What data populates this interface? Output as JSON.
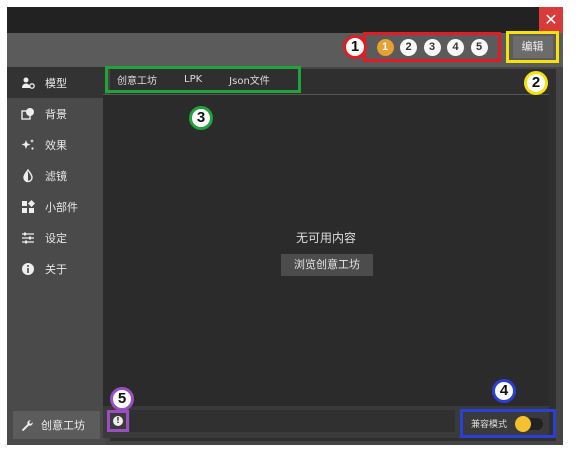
{
  "window": {
    "close_glyph": "✕"
  },
  "topbar": {
    "slots": [
      {
        "label": "1",
        "active": true
      },
      {
        "label": "2",
        "active": false
      },
      {
        "label": "3",
        "active": false
      },
      {
        "label": "4",
        "active": false
      },
      {
        "label": "5",
        "active": false
      }
    ],
    "edit_label": "编辑"
  },
  "sidebar": {
    "items": [
      {
        "label": "模型",
        "icon": "model-icon",
        "active": true
      },
      {
        "label": "背景",
        "icon": "background-icon",
        "active": false
      },
      {
        "label": "效果",
        "icon": "effects-icon",
        "active": false
      },
      {
        "label": "滤镜",
        "icon": "filter-icon",
        "active": false
      },
      {
        "label": "小部件",
        "icon": "widgets-icon",
        "active": false
      },
      {
        "label": "设定",
        "icon": "settings-icon",
        "active": false
      },
      {
        "label": "关于",
        "icon": "about-icon",
        "active": false
      }
    ],
    "workshop_label": "创意工坊"
  },
  "tabs": [
    "创意工坊",
    "LPK",
    "Json文件"
  ],
  "content": {
    "empty_title": "无可用内容",
    "browse_label": "浏览创意工坊"
  },
  "footer": {
    "info_glyph": "!",
    "compat_label": "兼容模式",
    "compat_on": true
  },
  "callouts": [
    "1",
    "2",
    "3",
    "4",
    "5"
  ],
  "colors": {
    "accent": "#e8a030",
    "callout_1": "#e31b23",
    "callout_2": "#f5e20d",
    "callout_3": "#1fa33a",
    "callout_4": "#2b3fd6",
    "callout_5": "#9b4ec0"
  }
}
